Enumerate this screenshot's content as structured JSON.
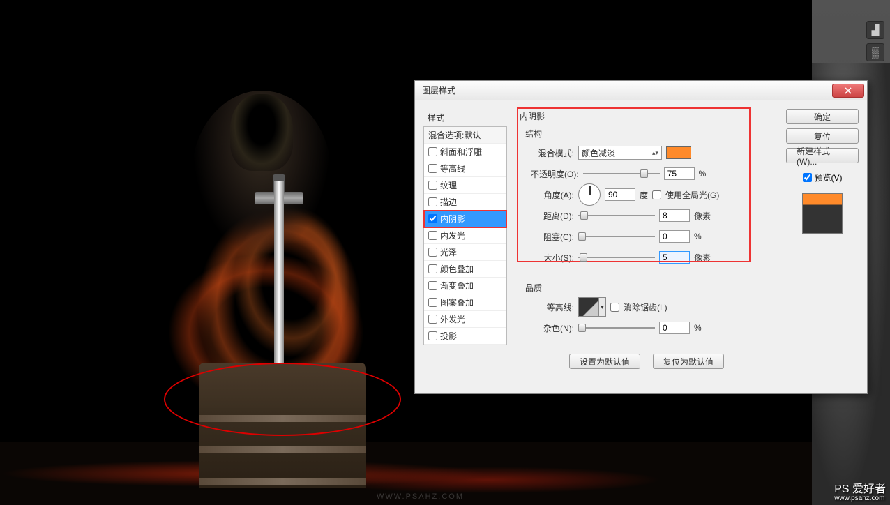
{
  "dialog": {
    "title": "图层样式",
    "styles_header": "样式",
    "blend_options": "混合选项:默认",
    "style_items": [
      {
        "label": "斜面和浮雕",
        "checked": false
      },
      {
        "label": "等高线",
        "checked": false
      },
      {
        "label": "纹理",
        "checked": false
      },
      {
        "label": "描边",
        "checked": false
      },
      {
        "label": "内阴影",
        "checked": true,
        "selected": true
      },
      {
        "label": "内发光",
        "checked": false
      },
      {
        "label": "光泽",
        "checked": false
      },
      {
        "label": "颜色叠加",
        "checked": false
      },
      {
        "label": "渐变叠加",
        "checked": false
      },
      {
        "label": "图案叠加",
        "checked": false
      },
      {
        "label": "外发光",
        "checked": false
      },
      {
        "label": "投影",
        "checked": false
      }
    ],
    "section_title": "内阴影",
    "structure_label": "结构",
    "blend_mode_label": "混合模式:",
    "blend_mode_value": "颜色减淡",
    "color_swatch": "#ff8a2a",
    "opacity_label": "不透明度(O):",
    "opacity_value": "75",
    "opacity_unit": "%",
    "angle_label": "角度(A):",
    "angle_value": "90",
    "angle_unit": "度",
    "global_light_label": "使用全局光(G)",
    "global_light_checked": false,
    "distance_label": "距离(D):",
    "distance_value": "8",
    "distance_unit": "像素",
    "choke_label": "阻塞(C):",
    "choke_value": "0",
    "choke_unit": "%",
    "size_label": "大小(S):",
    "size_value": "5",
    "size_unit": "像素",
    "quality_label": "品质",
    "contour_label": "等高线:",
    "antialias_label": "消除锯齿(L)",
    "antialias_checked": false,
    "noise_label": "杂色(N):",
    "noise_value": "0",
    "noise_unit": "%",
    "set_default": "设置为默认值",
    "reset_default": "复位为默认值",
    "ok": "确定",
    "cancel": "复位",
    "new_style": "新建样式(W)...",
    "preview_label": "预览(V)",
    "preview_checked": true
  },
  "watermark_url": "WWW.PSAHZ.COM",
  "watermark_logo": "PS 爱好者",
  "watermark_sub": "www.psahz.com"
}
